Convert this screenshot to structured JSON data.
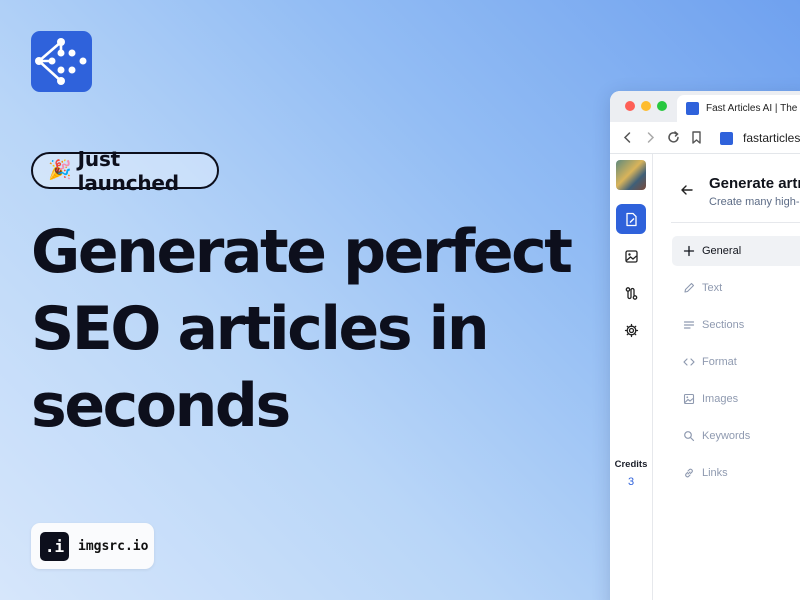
{
  "badge": {
    "emoji": "🎉",
    "text": "Just launched"
  },
  "headline": {
    "lines": [
      "Generate perfect",
      "SEO articles in",
      "seconds"
    ]
  },
  "imgsrc": {
    "mark": ".i",
    "name": "imgsrc.io"
  },
  "browser": {
    "tab_title": "Fast Articles AI | The #",
    "url": "fastarticles"
  },
  "app": {
    "title": "Generate artı",
    "subtitle": "Create many high-",
    "credits_label": "Credits",
    "credits_value": "3",
    "menu": [
      {
        "label": "General",
        "icon": "plus-icon",
        "active": true
      },
      {
        "label": "Text",
        "icon": "pencil-icon"
      },
      {
        "label": "Sections",
        "icon": "list-icon"
      },
      {
        "label": "Format",
        "icon": "code-icon"
      },
      {
        "label": "Images",
        "icon": "image-icon"
      },
      {
        "label": "Keywords",
        "icon": "search-icon"
      },
      {
        "label": "Links",
        "icon": "link-icon"
      }
    ]
  },
  "colors": {
    "brand": "#2f62db",
    "text_dark": "#0d0f1c",
    "muted": "#8f9ab0"
  }
}
